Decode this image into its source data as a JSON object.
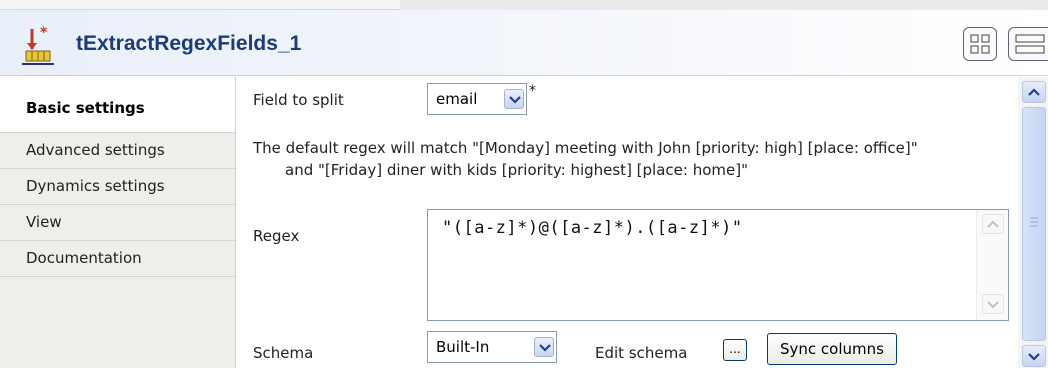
{
  "header": {
    "component_title": "tExtractRegexFields_1",
    "component_icon": "extract-regex-component-icon",
    "layout_buttons": [
      "two-column-layout-icon",
      "stacked-layout-icon"
    ]
  },
  "sidebar": {
    "items": [
      {
        "label": "Basic settings",
        "active": true
      },
      {
        "label": "Advanced settings",
        "active": false
      },
      {
        "label": "Dynamics settings",
        "active": false
      },
      {
        "label": "View",
        "active": false
      },
      {
        "label": "Documentation",
        "active": false
      }
    ]
  },
  "form": {
    "field_to_split": {
      "label": "Field to split",
      "value": "email",
      "required_marker": "*"
    },
    "info_line1": "The default regex will match \"[Monday] meeting with John [priority: high] [place: office]\"",
    "info_line2": "and \"[Friday] diner with kids [priority: highest] [place: home]\"",
    "regex": {
      "label": "Regex",
      "value": "\"([a-z]*)@([a-z]*).([a-z]*)\""
    },
    "schema": {
      "label": "Schema",
      "value": "Built-In",
      "edit_label": "Edit schema",
      "edit_button": "...",
      "sync_button": "Sync columns"
    }
  },
  "colors": {
    "title": "#1a3c78",
    "accent": "#2f5fbf",
    "sidebar_bg": "#eeeeea"
  }
}
